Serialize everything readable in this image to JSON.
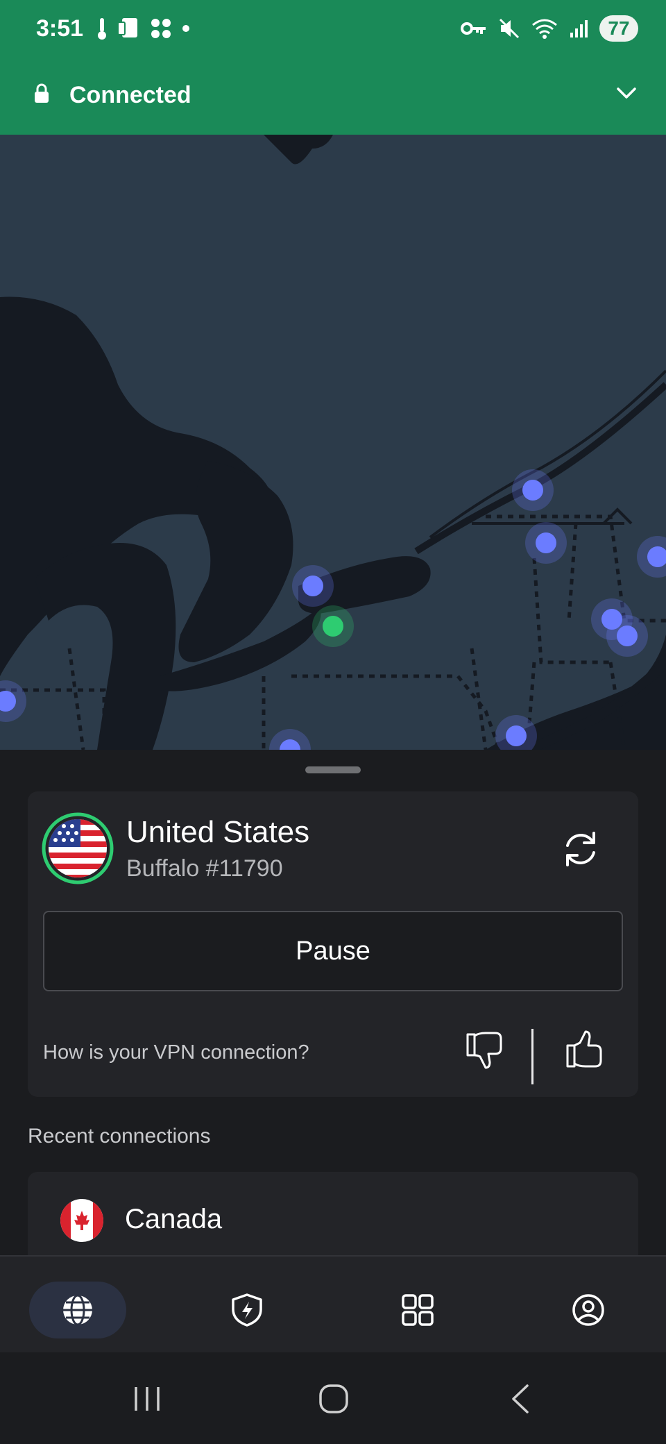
{
  "status_bar": {
    "time": "3:51",
    "battery": "77"
  },
  "connection": {
    "status": "Connected"
  },
  "current": {
    "country": "United States",
    "server": "Buffalo #11790",
    "pause_label": "Pause",
    "feedback_question": "How is your VPN connection?"
  },
  "recent": {
    "title": "Recent connections",
    "items": [
      {
        "country": "Canada"
      }
    ]
  },
  "colors": {
    "accent_green": "#1a8a58",
    "server_dot": "#6b7cff",
    "connected_dot": "#2ecc71",
    "map_land": "#2c3b4a",
    "map_water": "#151a22"
  },
  "icons": {
    "connected": "lock-icon",
    "expand": "chevron-down-icon",
    "refresh": "refresh-icon",
    "dislike": "thumbs-down-icon",
    "like": "thumbs-up-icon",
    "nav": [
      "globe-icon",
      "shield-bolt-icon",
      "grid-icon",
      "profile-icon"
    ]
  }
}
